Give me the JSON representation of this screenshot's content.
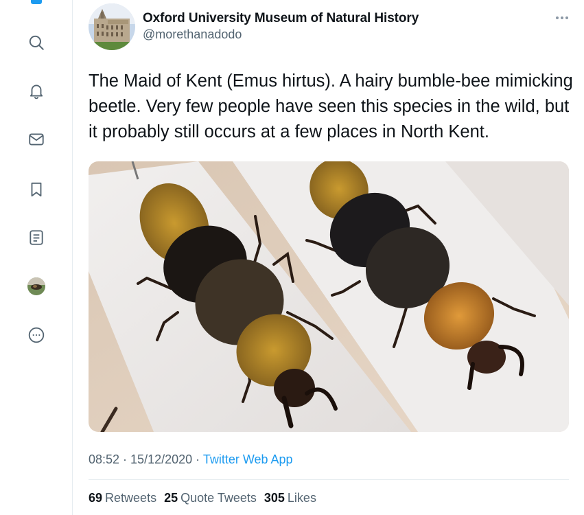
{
  "author": {
    "name": "Oxford University Museum of Natural History",
    "handle": "@morethanadodo"
  },
  "tweet": {
    "text": "The Maid of Kent (Emus hirtus). A hairy bumble-bee mimicking beetle. Very few people have seen this species in the wild, but it probably still occurs at a few places in North Kent."
  },
  "meta": {
    "time": "08:52",
    "separator1": " · ",
    "date": "15/12/2020",
    "separator2": " · ",
    "source": "Twitter Web App"
  },
  "stats": {
    "retweets_count": "69",
    "retweets_label": "Retweets",
    "quotes_count": "25",
    "quotes_label": "Quote Tweets",
    "likes_count": "305",
    "likes_label": "Likes"
  },
  "nav": {
    "icons": [
      "search-icon",
      "notifications-icon",
      "messages-icon",
      "bookmarks-icon",
      "lists-icon",
      "profile-avatar",
      "more-options-icon"
    ]
  },
  "colors": {
    "accent": "#1d9bf0",
    "text_primary": "#0f1419",
    "text_secondary": "#536471",
    "divider": "#e6ecf0"
  }
}
